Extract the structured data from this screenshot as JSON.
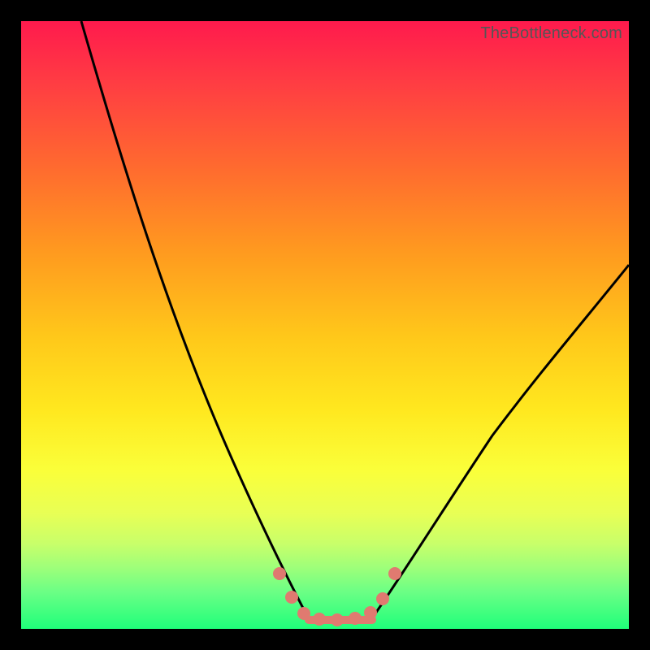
{
  "watermark": "TheBottleneck.com",
  "chart_data": {
    "type": "line",
    "title": "",
    "xlabel": "",
    "ylabel": "",
    "xlim": [
      0,
      100
    ],
    "ylim": [
      0,
      100
    ],
    "series": [
      {
        "name": "left-curve",
        "x": [
          10,
          15,
          20,
          25,
          30,
          35,
          40,
          44,
          47
        ],
        "values": [
          100,
          84,
          68,
          53,
          39,
          26,
          15,
          7,
          2
        ]
      },
      {
        "name": "right-curve",
        "x": [
          58,
          63,
          68,
          74,
          80,
          87,
          94,
          100
        ],
        "values": [
          2,
          7,
          14,
          22,
          31,
          41,
          51,
          60
        ]
      },
      {
        "name": "valley-flat",
        "x": [
          47,
          58
        ],
        "values": [
          1.5,
          1.5
        ]
      }
    ],
    "markers": [
      {
        "x": 42.5,
        "y": 9
      },
      {
        "x": 44.5,
        "y": 5.2
      },
      {
        "x": 46.5,
        "y": 2.5
      },
      {
        "x": 49,
        "y": 1.6
      },
      {
        "x": 52,
        "y": 1.5
      },
      {
        "x": 55,
        "y": 1.7
      },
      {
        "x": 57.5,
        "y": 2.7
      },
      {
        "x": 59.5,
        "y": 5
      },
      {
        "x": 61.5,
        "y": 9
      }
    ],
    "gradient_stops": [
      {
        "pos": 0,
        "color": "#ff1a4d"
      },
      {
        "pos": 50,
        "color": "#ffd020"
      },
      {
        "pos": 100,
        "color": "#1fff7a"
      }
    ]
  }
}
